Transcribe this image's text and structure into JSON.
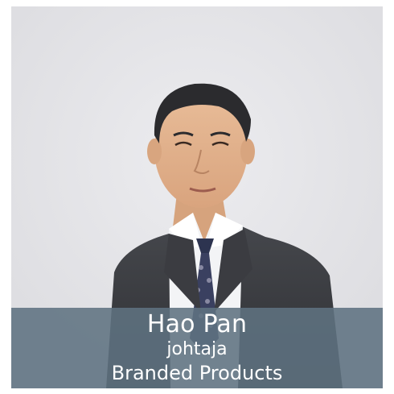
{
  "profile": {
    "name": "Hao Pan",
    "role": "johtaja",
    "unit": "Branded Products"
  },
  "colors": {
    "background": "#e4e4e7",
    "caption_bar": "#5e7281",
    "caption_text": "#ffffff",
    "suit": "#3a3b3f",
    "shirt": "#f4f5f7",
    "skin": "#e2b48e",
    "hair": "#2a2a2c",
    "tie": "#2e3550"
  },
  "image": {
    "subject": "portrait photo"
  }
}
